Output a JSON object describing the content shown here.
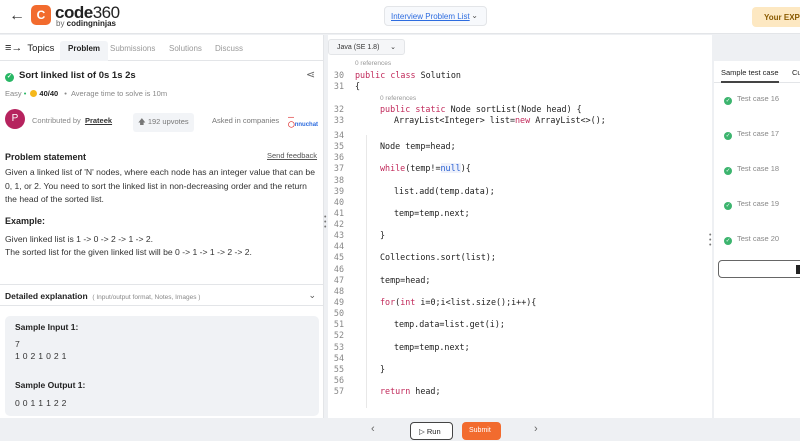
{
  "header": {
    "back_icon": "arrow-left-icon",
    "logo_mark": "C",
    "logo_word": "code",
    "logo_num": "360",
    "logo_by": "by ",
    "logo_brand": "codingninjas",
    "breadcrumb": "Interview Problem List",
    "exp_button": "Your EXP"
  },
  "left": {
    "topics": "Topics",
    "tabs": [
      "Problem",
      "Submissions",
      "Solutions",
      "Discuss"
    ],
    "title": "Sort linked list of 0s 1s 2s",
    "difficulty": "Easy",
    "points": "40/40",
    "avg_time": "Average time to solve is 10m",
    "avatar_letter": "P",
    "contributed_by": "Contributed by",
    "contributor": "Prateek",
    "upvotes": "192 upvotes",
    "asked_in": "Asked in companies",
    "company_logo_text": "nnuchat",
    "problem_statement_heading": "Problem statement",
    "send_feedback": "Send feedback",
    "statement": "Given a linked list of 'N' nodes, where each node has an integer value that can be 0, 1, or 2. You need to sort the linked list in non-decreasing order and the return the head of the sorted list.",
    "example_heading": "Example:",
    "example_line1": "Given linked list is 1 -> 0 -> 2 -> 1 -> 2.",
    "example_line2": "The sorted list for the given linked list will be 0 -> 1 -> 1 -> 2 -> 2.",
    "detailed_heading": "Detailed explanation",
    "detailed_sub": "( Input/output format, Notes, Images )",
    "sample_input_heading": "Sample Input 1:",
    "sample_input_line1": "7",
    "sample_input_line2": "1 0 2 1 0 2 1",
    "sample_output_heading": "Sample Output 1:",
    "sample_output_line1": "0 0 1 1 1 2 2"
  },
  "editor": {
    "language": "Java (SE 1.8)",
    "references_label": "0 references",
    "lines": [
      {
        "n": "30",
        "text": "public class Solution"
      },
      {
        "n": "31",
        "text": "{"
      },
      {
        "n": "32",
        "text": "public static Node sortList(Node head) {"
      },
      {
        "n": "33",
        "text": "ArrayList<Integer> list=new ArrayList<>();"
      },
      {
        "n": "34",
        "text": ""
      },
      {
        "n": "35",
        "text": "Node temp=head;"
      },
      {
        "n": "36",
        "text": ""
      },
      {
        "n": "37",
        "text": "while(temp!=null){"
      },
      {
        "n": "38",
        "text": ""
      },
      {
        "n": "39",
        "text": "list.add(temp.data);"
      },
      {
        "n": "40",
        "text": ""
      },
      {
        "n": "41",
        "text": "temp=temp.next;"
      },
      {
        "n": "42",
        "text": ""
      },
      {
        "n": "43",
        "text": "}"
      },
      {
        "n": "44",
        "text": ""
      },
      {
        "n": "45",
        "text": "Collections.sort(list);"
      },
      {
        "n": "46",
        "text": ""
      },
      {
        "n": "47",
        "text": "temp=head;"
      },
      {
        "n": "48",
        "text": ""
      },
      {
        "n": "49",
        "text": "for(int i=0;i<list.size();i++){"
      },
      {
        "n": "50",
        "text": ""
      },
      {
        "n": "51",
        "text": "temp.data=list.get(i);"
      },
      {
        "n": "52",
        "text": ""
      },
      {
        "n": "53",
        "text": "temp=temp.next;"
      },
      {
        "n": "54",
        "text": ""
      },
      {
        "n": "55",
        "text": "}"
      },
      {
        "n": "56",
        "text": ""
      },
      {
        "n": "57",
        "text": "return head;"
      }
    ]
  },
  "tests": {
    "tabs": [
      "Sample test case",
      "Cu"
    ],
    "cases": [
      "Test case 16",
      "Test case 17",
      "Test case 18",
      "Test case 19",
      "Test case 20"
    ]
  },
  "footer": {
    "prev": "‹",
    "next": "›",
    "run": "Run",
    "submit": "Submit"
  },
  "colors": {
    "brand": "#f26b2e",
    "success": "#29b765",
    "keyword": "#c1295a"
  }
}
